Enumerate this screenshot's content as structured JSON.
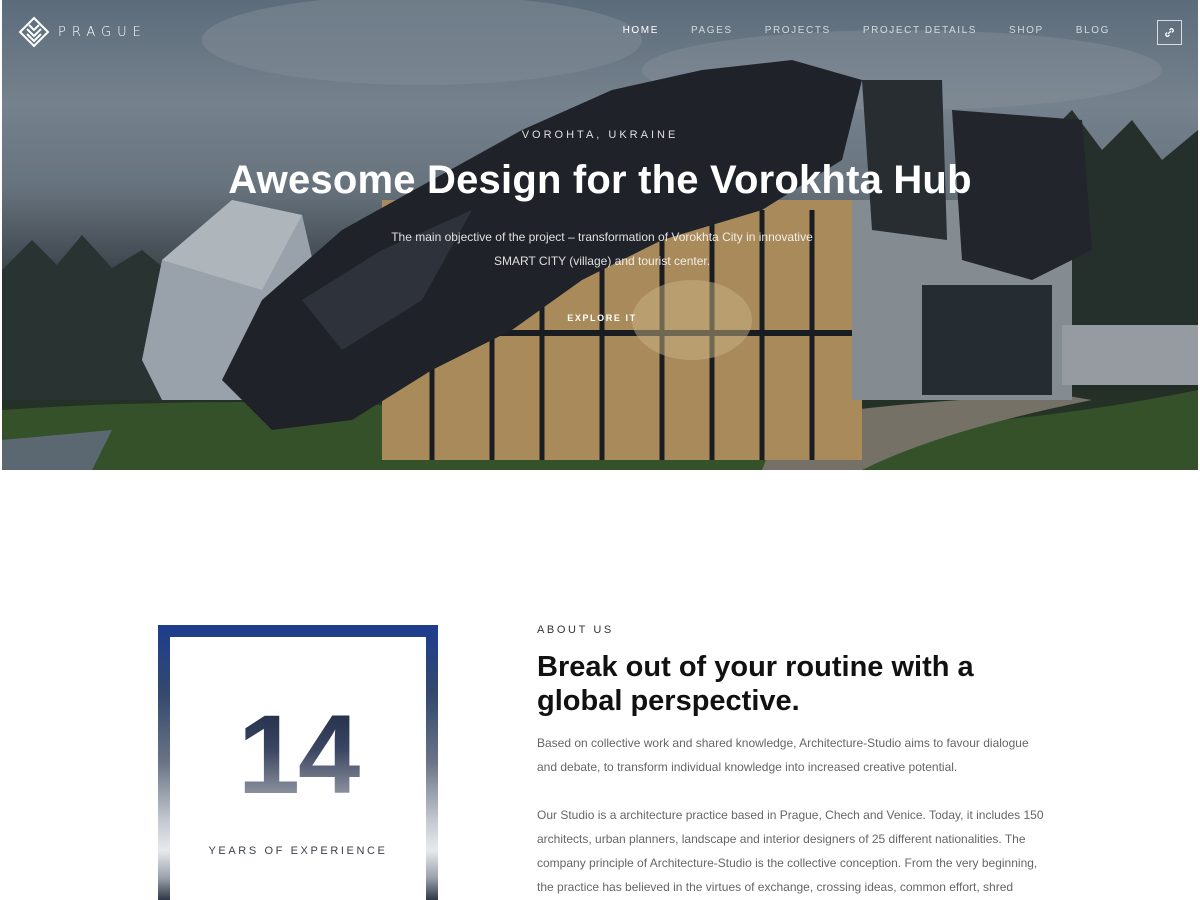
{
  "brand": {
    "name": "PRAGUE",
    "logo_icon": "layered-diamond-logo-icon"
  },
  "nav": {
    "items": [
      {
        "label": "HOME",
        "active": true
      },
      {
        "label": "PAGES",
        "active": false
      },
      {
        "label": "PROJECTS",
        "active": false
      },
      {
        "label": "PROJECT DETAILS",
        "active": false
      },
      {
        "label": "SHOP",
        "active": false
      },
      {
        "label": "BLOG",
        "active": false
      }
    ],
    "action_icon": "link-icon"
  },
  "hero": {
    "eyebrow": "VOROHTA, UKRAINE",
    "title": "Awesome Design for the Vorokhta Hub",
    "description_line1": "The main objective of the project – transformation of Vorokhta City in innovative",
    "description_line2": "SMART CITY (village) and tourist center.",
    "cta": "EXPLORE IT"
  },
  "experience": {
    "number": "14",
    "label": "YEARS OF EXPERIENCE"
  },
  "about": {
    "eyebrow": "ABOUT US",
    "title": "Break out of your routine with a global perspective.",
    "paragraph1": "Based on collective work and shared knowledge, Architecture-Studio aims to favour dialogue and debate, to transform individual knowledge into increased creative potential.",
    "paragraph2": "Our Studio is a architecture practice based in Prague, Chech and Venice. Today, it includes 150 architects, urban planners, landscape and interior designers of 25 different nationalities. The company principle of Architecture-Studio is the collective conception. From the very beginning, the practice has believed in the virtues of exchange, crossing ideas, common effort, shred"
  },
  "colors": {
    "accent_blue": "#1d3d8e",
    "text_dark": "#111111",
    "text_muted": "#666666"
  }
}
